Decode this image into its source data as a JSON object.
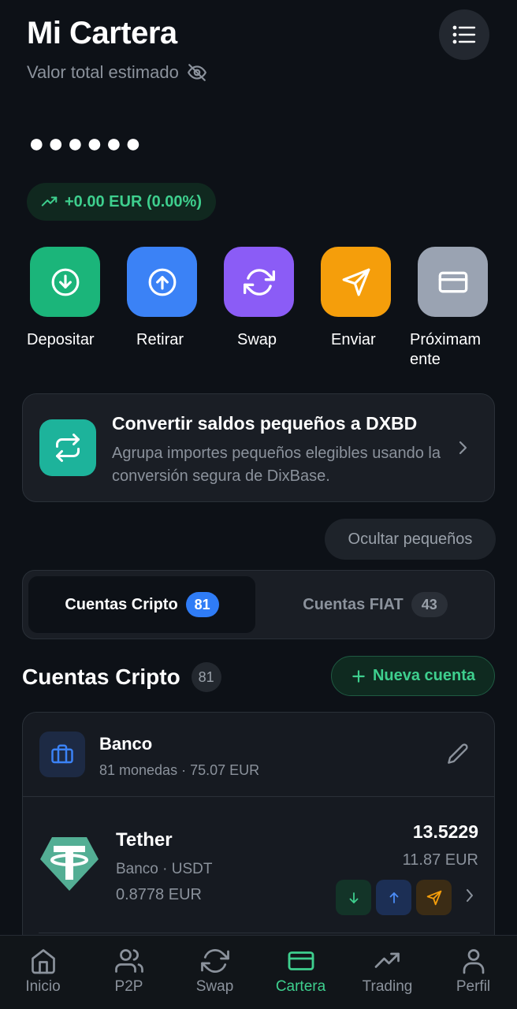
{
  "header": {
    "title": "Mi Cartera",
    "subtitle": "Valor total estimado",
    "balance_masked": "●●●●●●",
    "change": "+0.00 EUR (0.00%)"
  },
  "actions": [
    {
      "label": "Depositar",
      "color": "#1bb57a",
      "icon": "arrow-down-circle-icon"
    },
    {
      "label": "Retirar",
      "color": "#3b82f6",
      "icon": "arrow-up-circle-icon"
    },
    {
      "label": "Swap",
      "color": "#8b5cf6",
      "icon": "refresh-icon"
    },
    {
      "label": "Enviar",
      "color": "#f59e0b",
      "icon": "send-icon"
    },
    {
      "label": "Próximam ente",
      "color": "#9aa3b2",
      "icon": "card-icon"
    }
  ],
  "convert": {
    "title": "Convertir saldos pequeños a DXBD",
    "description": "Agrupa importes pequeños elegibles usando la conversión segura de DixBase."
  },
  "hide_small_label": "Ocultar pequeños",
  "tabs": [
    {
      "label": "Cuentas Cripto",
      "count": "81"
    },
    {
      "label": "Cuentas FIAT",
      "count": "43"
    }
  ],
  "section": {
    "title": "Cuentas Cripto",
    "count": "81",
    "new_account_label": "Nueva cuenta"
  },
  "bank": {
    "name": "Banco",
    "summary": "81 monedas · 75.07 EUR"
  },
  "asset": {
    "name": "Tether",
    "subtitle": "Banco · USDT",
    "price_eur": "0.8778 EUR",
    "amount": "13.5229",
    "value": "11.87 EUR"
  },
  "nav": [
    {
      "label": "Inicio",
      "icon": "home-icon"
    },
    {
      "label": "P2P",
      "icon": "users-icon"
    },
    {
      "label": "Swap",
      "icon": "refresh-icon"
    },
    {
      "label": "Cartera",
      "icon": "wallet-icon",
      "active": true
    },
    {
      "label": "Trading",
      "icon": "trending-up-icon"
    },
    {
      "label": "Perfil",
      "icon": "user-icon"
    }
  ],
  "colors": {
    "background": "#0d1117",
    "accent_green": "#3ecf8e",
    "accent_blue": "#2f7cf6",
    "tether": "#53ae94"
  }
}
